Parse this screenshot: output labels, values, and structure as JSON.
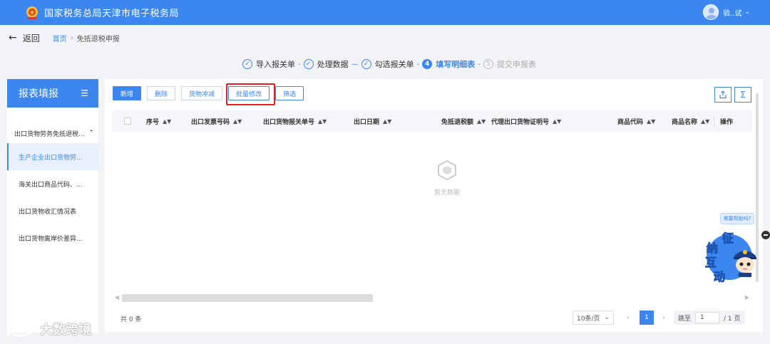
{
  "header": {
    "site_title": "国家税务总局天津市电子税务局",
    "user_name": "验..试",
    "user_caret": "⌄",
    "brand_color": "#3c86f0"
  },
  "nav": {
    "back_label": "返回",
    "breadcrumb": {
      "home": "首页",
      "separator": "›",
      "current": "免抵退税申报"
    }
  },
  "steps": [
    {
      "label": "导入报关单",
      "state": "done",
      "icon": "check-circle-icon"
    },
    {
      "label": "处理数据",
      "state": "done",
      "icon": "check-circle-icon"
    },
    {
      "label": "勾选报关单",
      "state": "done",
      "icon": "check-circle-icon"
    },
    {
      "label": "填写明细表",
      "state": "active",
      "number": "4"
    },
    {
      "label": "提交申报表",
      "state": "todo",
      "number": "5"
    }
  ],
  "sidebar": {
    "title": "报表填报",
    "group_label": "出口货物劳务免抵退税...",
    "items": [
      {
        "label": "生产企业出口货物劳...",
        "active": true
      },
      {
        "label": "海关出口商品代码、..."
      },
      {
        "label": "出口货物收汇情况表"
      },
      {
        "label": "出口货物离岸价差异..."
      }
    ]
  },
  "toolbar": {
    "add": "新增",
    "delete": "删除",
    "goods_offset": "货物冲减",
    "batch_edit": "批量修改",
    "filter": "筛选"
  },
  "table": {
    "columns": [
      "序号",
      "出口发票号码",
      "出口货物报关单号",
      "出口日期",
      "免抵退税额",
      "代理出口货物证明号",
      "商品代码",
      "商品名称",
      "操作"
    ],
    "rows": [],
    "empty_text": "暂无数据"
  },
  "pagination": {
    "total": "共 0 条",
    "page_size": "10条/页",
    "prev": "‹",
    "current_page": "1",
    "next": "›",
    "jump_label": "跳至",
    "jump_value": "1",
    "page_total": "/ 1 页"
  },
  "assistant": {
    "help_text": "需要帮助吗?",
    "chars": [
      "征",
      "纳",
      "互",
      "动"
    ]
  },
  "watermark": "大数跨境"
}
